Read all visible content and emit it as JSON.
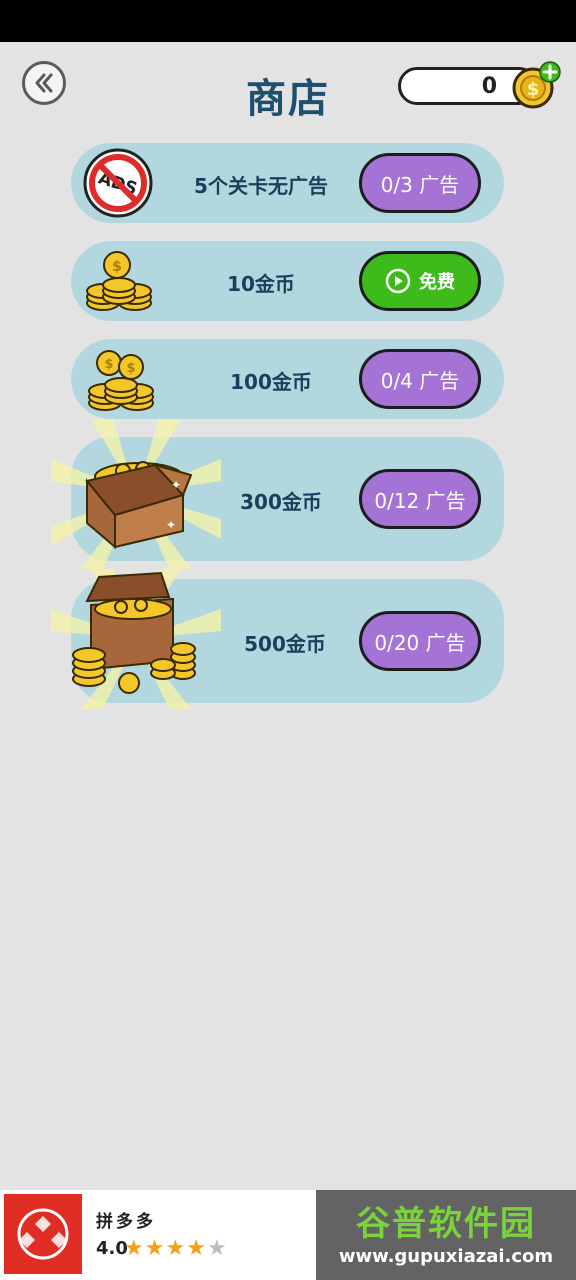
{
  "header": {
    "title": "商店",
    "coin_balance": "0"
  },
  "shop_items": [
    {
      "label": "5个关卡无广告",
      "button": "0/3 广告",
      "button_type": "ad",
      "icon": "no-ads-icon"
    },
    {
      "label": "10金币",
      "button": "免费",
      "button_type": "free",
      "icon": "coin-stack-small-icon"
    },
    {
      "label": "100金币",
      "button": "0/4 广告",
      "button_type": "ad",
      "icon": "coin-stack-icon"
    },
    {
      "label": "300金币",
      "button": "0/12 广告",
      "button_type": "ad",
      "icon": "coin-box-icon"
    },
    {
      "label": "500金币",
      "button": "0/20 广告",
      "button_type": "ad",
      "icon": "treasure-chest-icon"
    }
  ],
  "ad_banner": {
    "app_name": "拼多多",
    "rating": "4.0",
    "stars_filled": 4,
    "stars_total": 5
  },
  "watermark": {
    "title": "谷普软件园",
    "url": "www.gupuxiazai.com"
  },
  "colors": {
    "background": "#e3e3e3",
    "card": "#b3d7de",
    "title": "#1e4f6f",
    "ad_button": "#a572d6",
    "free_button": "#3dbb1b"
  }
}
